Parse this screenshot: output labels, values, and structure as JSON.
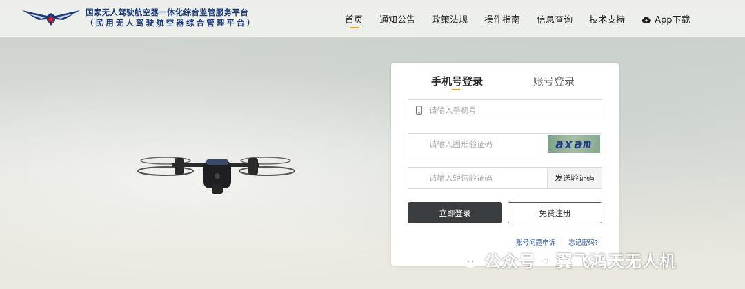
{
  "header": {
    "brand_line1": "国家无人驾驶航空器一体化综合监管服务平台",
    "brand_line2": "（民用无人驾驶航空器综合管理平台）",
    "nav": [
      {
        "label": "首页",
        "active": true
      },
      {
        "label": "通知公告"
      },
      {
        "label": "政策法规"
      },
      {
        "label": "操作指南"
      },
      {
        "label": "信息查询"
      },
      {
        "label": "技术支持"
      },
      {
        "label": "App下载",
        "icon": "cloud-download-icon"
      }
    ]
  },
  "login": {
    "tabs": [
      {
        "label": "手机号登录",
        "active": true
      },
      {
        "label": "账号登录"
      }
    ],
    "phone_placeholder": "请输入手机号",
    "captcha_placeholder": "请输入图形验证码",
    "captcha_text": "axam",
    "sms_placeholder": "请输入短信验证码",
    "sms_button": "发送验证码",
    "login_button": "立即登录",
    "register_button": "免费注册",
    "appeal_link": "账号问题申诉",
    "forgot_link": "忘记密码?"
  },
  "watermark": {
    "text": "公众号 · 翼飞鸿天无人机"
  },
  "colors": {
    "accent": "#e8a321",
    "brand_blue": "#1a3a7a",
    "link": "#2a5db0",
    "login_button_bg": "#3a3d40"
  }
}
